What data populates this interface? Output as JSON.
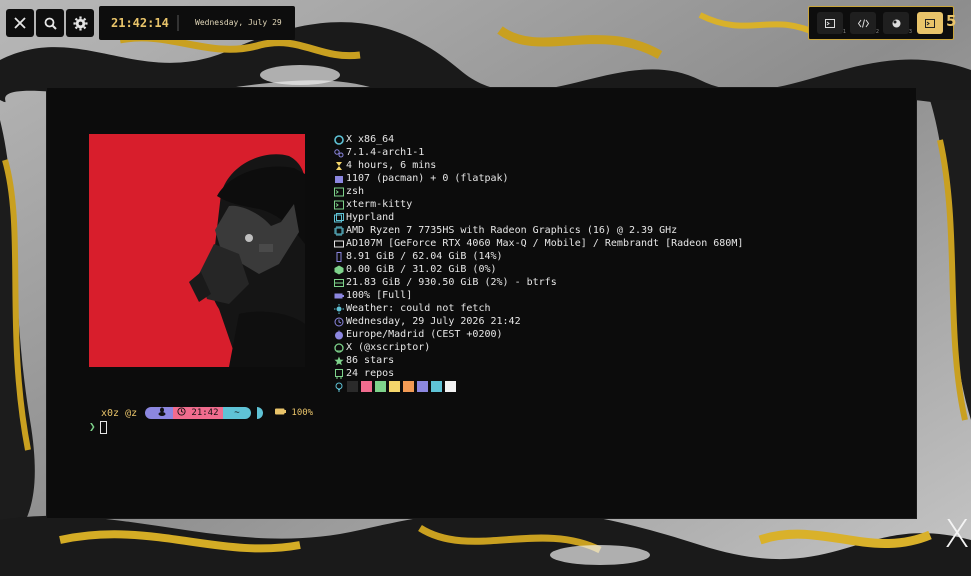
{
  "topbar": {
    "time": "21:42:14",
    "date": "Wednesday, July 29",
    "icons": [
      "close-icon",
      "search-icon",
      "gear-icon"
    ]
  },
  "workspaces": {
    "items": [
      {
        "icon": "terminal-icon",
        "sub": "1",
        "active": false
      },
      {
        "icon": "code-icon",
        "sub": "2",
        "active": false
      },
      {
        "icon": "browser-icon",
        "sub": "3",
        "active": false
      },
      {
        "icon": "terminal-icon",
        "sub": "4",
        "active": true
      }
    ],
    "count": "5"
  },
  "fetch": {
    "os": "X x86_64",
    "kernel": "7.1.4-arch1-1",
    "uptime": "4 hours, 6 mins",
    "packages": "1107 (pacman) + 0 (flatpak)",
    "shell": "zsh",
    "terminal": "xterm-kitty",
    "wm": "Hyprland",
    "cpu": "AMD Ryzen 7 7735HS with Radeon Graphics (16) @ 2.39 GHz",
    "gpu": "AD107M [GeForce RTX 4060 Max-Q / Mobile] / Rembrandt [Radeon 680M]",
    "memory": "8.91 GiB / 62.04 GiB (14%)",
    "swap": "0.00 GiB / 31.02 GiB (0%)",
    "disk": "21.83 GiB / 930.50 GiB (2%) - btrfs",
    "battery": "100% [Full]",
    "weather": "Weather: could not fetch",
    "datetime": "Wednesday, 29 July 2026  21:42",
    "timezone": "Europe/Madrid (CEST +0200)",
    "github": "X (@xscriptor)",
    "stars": "86 stars",
    "repos": "24 repos",
    "palette": [
      "#2a2a2a",
      "#f06c8e",
      "#7ed38b",
      "#f5d66b",
      "#f29a54",
      "#8c87e0",
      "#5fc3d6",
      "#f2f2f2"
    ]
  },
  "prompt": {
    "user": "x0z @z",
    "time": "21:42",
    "dir": "~",
    "battery": "100%",
    "symbol": "❯"
  },
  "colors": {
    "accent": "#e9c46a",
    "terminal_bg": "#0c0c0c"
  },
  "corner_glyph": "X"
}
